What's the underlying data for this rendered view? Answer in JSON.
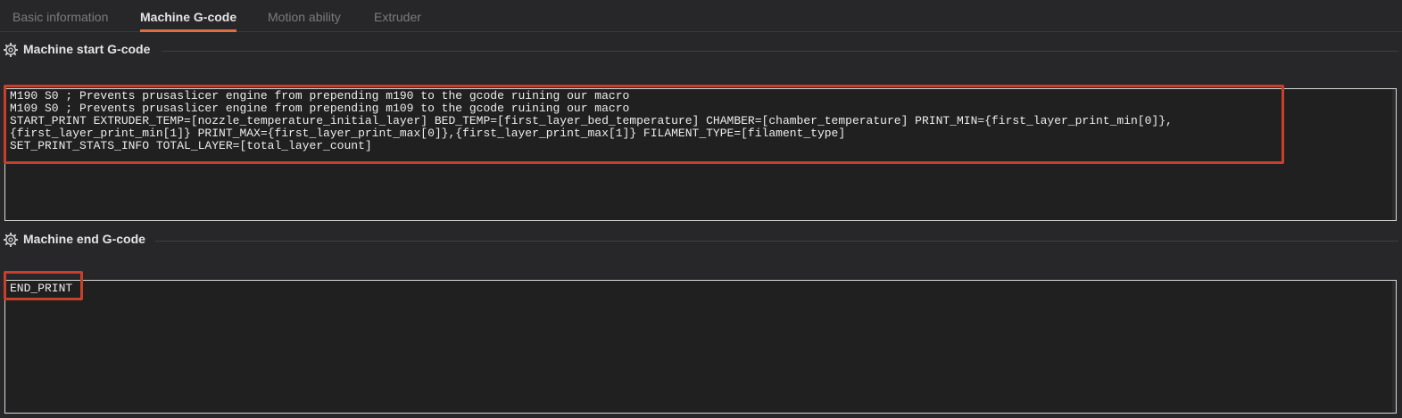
{
  "tabs": [
    {
      "label": "Basic information",
      "active": false
    },
    {
      "label": "Machine G-code",
      "active": true
    },
    {
      "label": "Motion ability",
      "active": false
    },
    {
      "label": "Extruder",
      "active": false
    }
  ],
  "sections": {
    "start": {
      "title": "Machine start G-code",
      "icon": "gear-icon",
      "code_lines": [
        "M190 S0 ; Prevents prusaslicer engine from prepending m190 to the gcode ruining our macro",
        "M109 S0 ; Prevents prusaslicer engine from prepending m109 to the gcode ruining our macro",
        "START_PRINT EXTRUDER_TEMP=[nozzle_temperature_initial_layer] BED_TEMP=[first_layer_bed_temperature] CHAMBER=[chamber_temperature] PRINT_MIN={first_layer_print_min[0]},",
        "{first_layer_print_min[1]} PRINT_MAX={first_layer_print_max[0]},{first_layer_print_max[1]} FILAMENT_TYPE=[filament_type]",
        "SET_PRINT_STATS_INFO TOTAL_LAYER=[total_layer_count]"
      ]
    },
    "end": {
      "title": "Machine end G-code",
      "icon": "gear-icon",
      "code_lines": [
        "END_PRINT"
      ]
    }
  },
  "colors": {
    "accent": "#e06d3d",
    "highlight": "#c8402c",
    "background": "#272729",
    "editor_background": "#202020"
  }
}
